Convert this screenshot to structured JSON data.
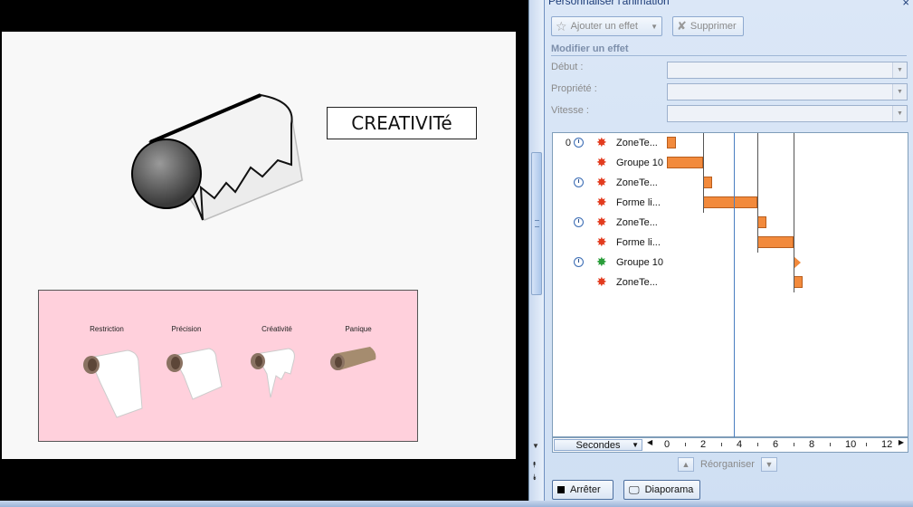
{
  "slide": {
    "title_box": "CREATIVITé",
    "panel_labels": [
      "Restriction",
      "Précision",
      "Créativité",
      "Panique"
    ]
  },
  "pane": {
    "title": "Personnaliser l'animation",
    "add_effect": "Ajouter un effet",
    "delete": "Supprimer",
    "modify_heading": "Modifier un effet",
    "start_label": "Début :",
    "property_label": "Propriété :",
    "speed_label": "Vitesse :",
    "reorder": "Réorganiser",
    "stop": "Arrêter",
    "slideshow": "Diaporama"
  },
  "animations": [
    {
      "num": "0",
      "clock": true,
      "star": "red",
      "label": "ZoneTe...",
      "bar_start": 0,
      "bar_end": 0.5,
      "shape": "bar"
    },
    {
      "num": "",
      "clock": false,
      "star": "red",
      "label": "Groupe 10",
      "bar_start": 0,
      "bar_end": 2,
      "shape": "bar"
    },
    {
      "num": "",
      "clock": true,
      "star": "red",
      "label": "ZoneTe...",
      "bar_start": 2,
      "bar_end": 2.5,
      "shape": "bar"
    },
    {
      "num": "",
      "clock": false,
      "star": "red",
      "label": "Forme li...",
      "bar_start": 2,
      "bar_end": 5,
      "shape": "bar"
    },
    {
      "num": "",
      "clock": true,
      "star": "red",
      "label": "ZoneTe...",
      "bar_start": 5,
      "bar_end": 5.5,
      "shape": "bar"
    },
    {
      "num": "",
      "clock": false,
      "star": "red",
      "label": "Forme li...",
      "bar_start": 5,
      "bar_end": 7,
      "shape": "bar"
    },
    {
      "num": "",
      "clock": true,
      "star": "green",
      "label": "Groupe 10",
      "bar_start": 7,
      "bar_end": 7.4,
      "shape": "triangle"
    },
    {
      "num": "",
      "clock": false,
      "star": "red",
      "label": "ZoneTe...",
      "bar_start": 7,
      "bar_end": 7.5,
      "shape": "bar"
    }
  ],
  "timeline": {
    "unit_label": "Secondes",
    "ticks": [
      "0",
      "2",
      "4",
      "6",
      "8",
      "10",
      "12"
    ],
    "cursor_seconds": 3.7
  },
  "colors": {
    "bar": "#f28a3c",
    "star_red": "#e23c1f",
    "star_green": "#2a9d3a",
    "pane_bg": "#dbe7f7"
  }
}
